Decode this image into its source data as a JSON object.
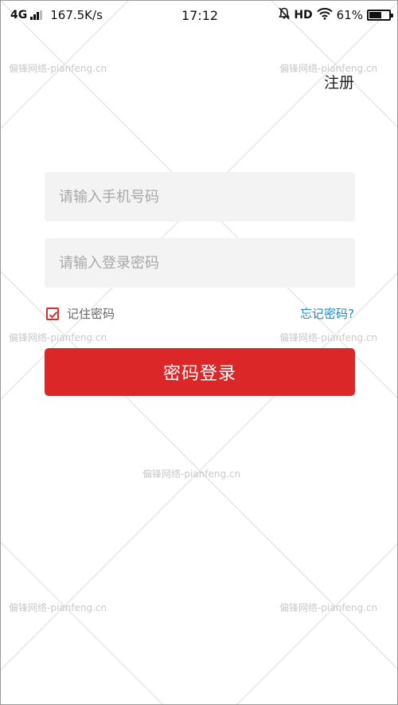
{
  "status_bar": {
    "network": "4G",
    "speed": "167.5K/s",
    "time": "17:12",
    "hd": "HD",
    "battery_percent": "61%",
    "battery_level": 0.61,
    "icons": [
      "signal-icon",
      "mute-bell-icon",
      "wifi-icon",
      "battery-icon"
    ]
  },
  "header": {
    "register_label": "注册"
  },
  "form": {
    "phone_placeholder": "请输入手机号码",
    "phone_value": "",
    "password_placeholder": "请输入登录密码",
    "password_value": "",
    "remember_label": "记住密码",
    "remember_checked": true,
    "forgot_label": "忘记密码?",
    "login_label": "密码登录"
  },
  "watermark": {
    "text": "偏锋网络-pianfeng.cn"
  },
  "colors": {
    "accent_red": "#dc2728",
    "link_blue": "#1e88c8",
    "input_bg": "#f3f3f3"
  }
}
